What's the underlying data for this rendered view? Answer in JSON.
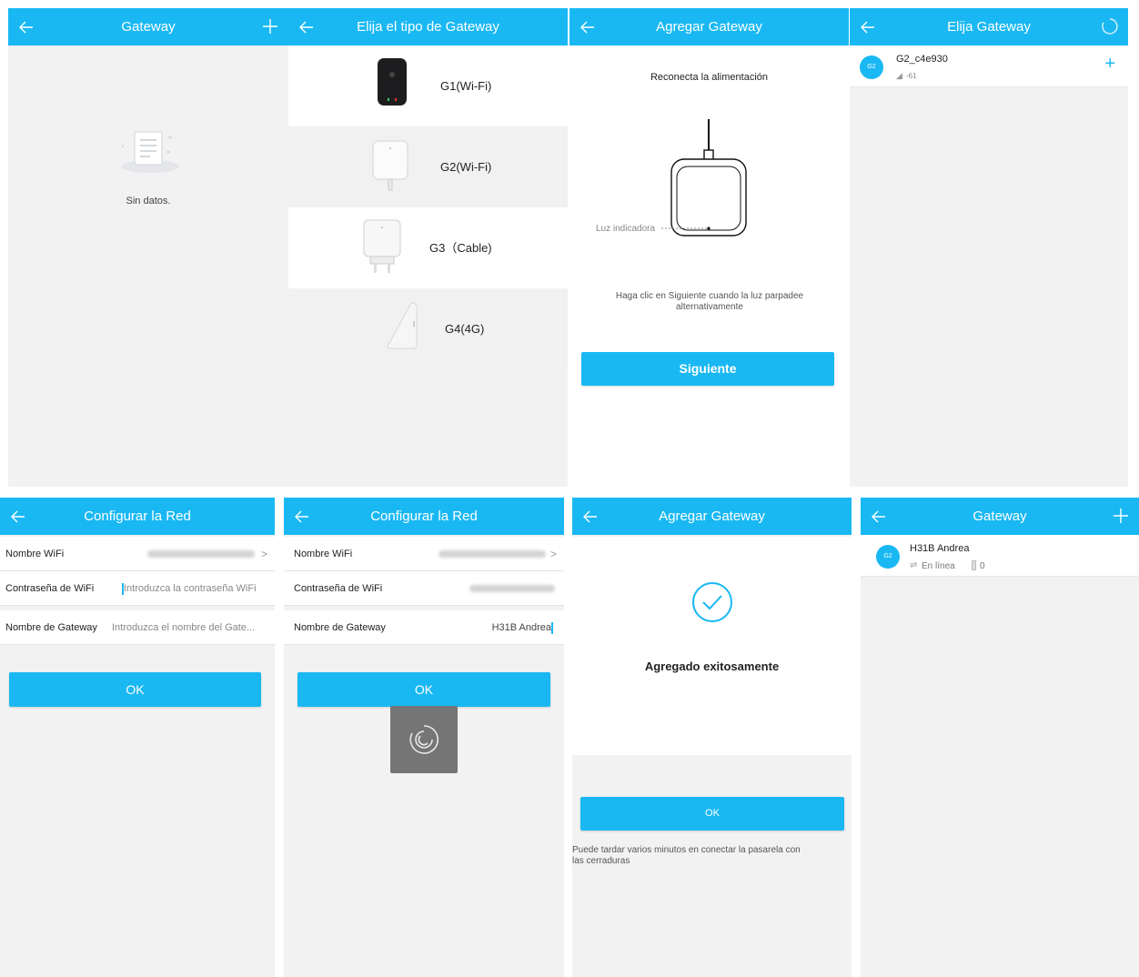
{
  "colors": {
    "accent": "#19b8f3",
    "background": "#f2f2f2"
  },
  "screen1": {
    "title": "Gateway",
    "empty_text": "Sin datos."
  },
  "screen2": {
    "title": "Elija el tipo de Gateway",
    "types": [
      {
        "label": "G1(Wi-Fi)"
      },
      {
        "label": "G2(Wi-Fi)"
      },
      {
        "label": "G3（Cable)"
      },
      {
        "label": "G4(4G)"
      }
    ]
  },
  "screen3": {
    "title": "Agregar Gateway",
    "instruction": "Reconecta la alimentación",
    "indicator_label": "Luz indicadora",
    "hint": "Haga clic en Siguiente cuando la luz parpadee alternativamente",
    "next_button": "Siguiente"
  },
  "screen4": {
    "title": "Elija Gateway",
    "item": {
      "badge": "G2",
      "name": "G2_c4e930",
      "signal": "-61"
    }
  },
  "screen5": {
    "title": "Configurar la Red",
    "wifi_name_label": "Nombre WiFi",
    "wifi_password_label": "Contraseña de WiFi",
    "wifi_password_placeholder": "Introduzca la contraseña WiFi",
    "gateway_name_label": "Nombre de Gateway",
    "gateway_name_placeholder": "Introduzca el nombre del Gate...",
    "ok_button": "OK"
  },
  "screen6": {
    "title": "Configurar la Red",
    "wifi_name_label": "Nombre WiFi",
    "wifi_password_label": "Contraseña de WiFi",
    "gateway_name_label": "Nombre de Gateway",
    "gateway_name_value": "H31B Andrea",
    "ok_button": "OK"
  },
  "screen7": {
    "title": "Agregar Gateway",
    "success_text": "Agregado exitosamente",
    "ok_button": "OK",
    "note": "Puede tardar varios minutos en conectar la pasarela con las cerraduras"
  },
  "screen8": {
    "title": "Gateway",
    "item": {
      "badge": "G2",
      "name": "H31B Andrea",
      "status": "En línea",
      "lock_count": "0"
    }
  }
}
